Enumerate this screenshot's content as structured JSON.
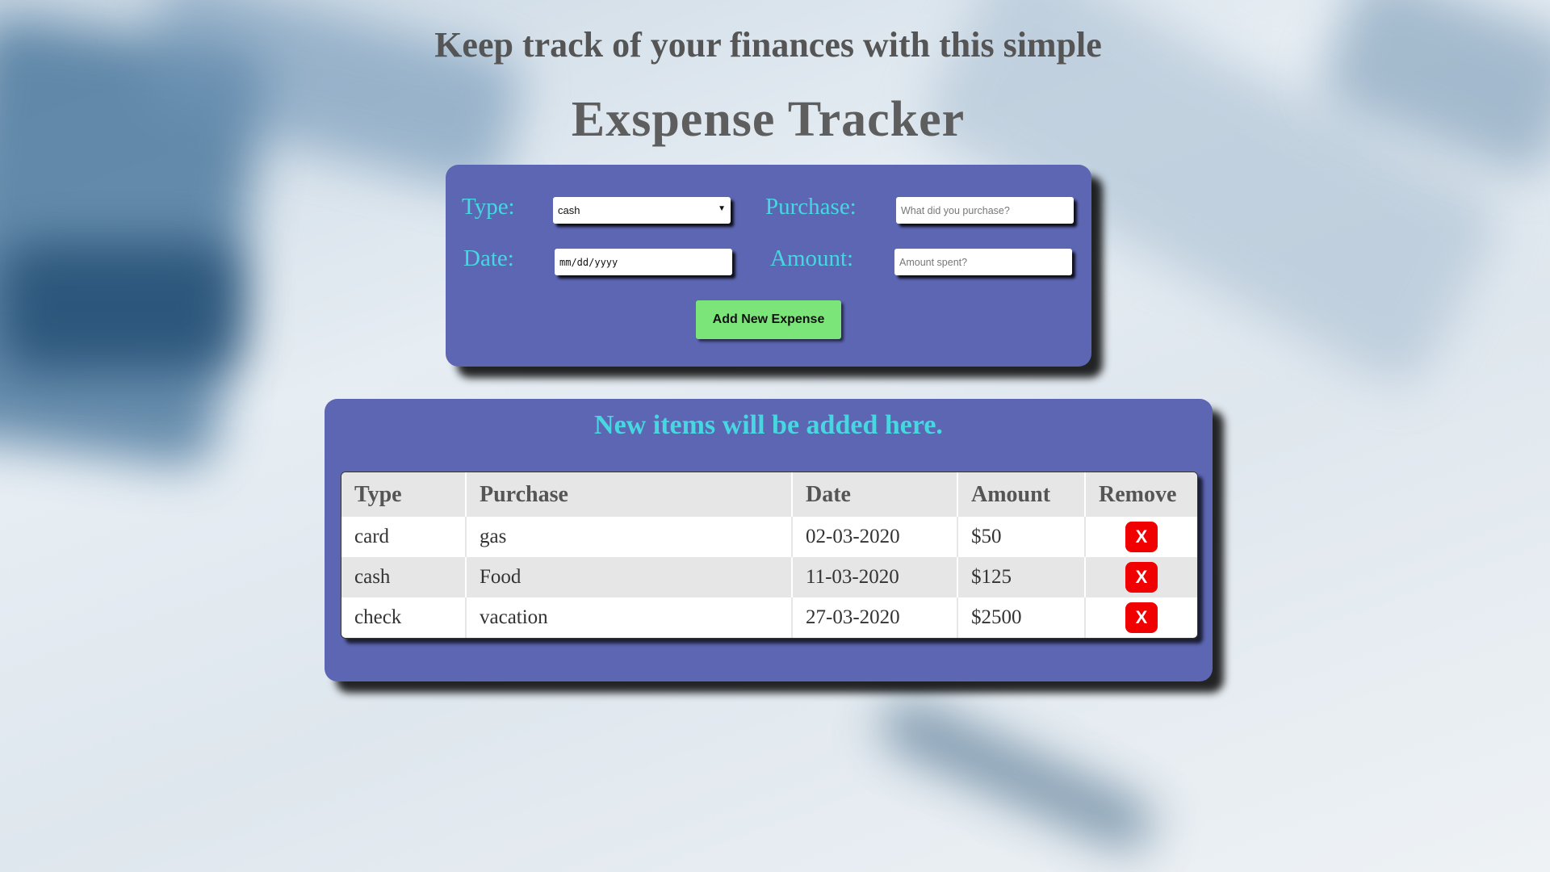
{
  "header": {
    "subtitle": "Keep track of your finances with this simple",
    "title": "Exspense Tracker"
  },
  "form": {
    "type_label": "Type:",
    "type_value": "cash",
    "purchase_label": "Purchase:",
    "purchase_placeholder": "What did you purchase?",
    "date_label": "Date:",
    "date_placeholder": "mm/dd/yyyy",
    "amount_label": "Amount:",
    "amount_placeholder": "Amount spent?",
    "add_button": "Add New Expense"
  },
  "list": {
    "heading": "New items will be added here.",
    "columns": [
      "Type",
      "Purchase",
      "Date",
      "Amount",
      "Remove"
    ],
    "rows": [
      {
        "type": "card",
        "purchase": "gas",
        "date": "02-03-2020",
        "amount": "$50",
        "remove": "X"
      },
      {
        "type": "cash",
        "purchase": "Food",
        "date": "11-03-2020",
        "amount": "$125",
        "remove": "X"
      },
      {
        "type": "check",
        "purchase": "vacation",
        "date": "27-03-2020",
        "amount": "$2500",
        "remove": "X"
      }
    ]
  },
  "colors": {
    "card_bg": "#5c66b3",
    "label_color": "#48d6e0",
    "add_button_bg": "#7be57a",
    "remove_button_bg": "#f00000"
  }
}
